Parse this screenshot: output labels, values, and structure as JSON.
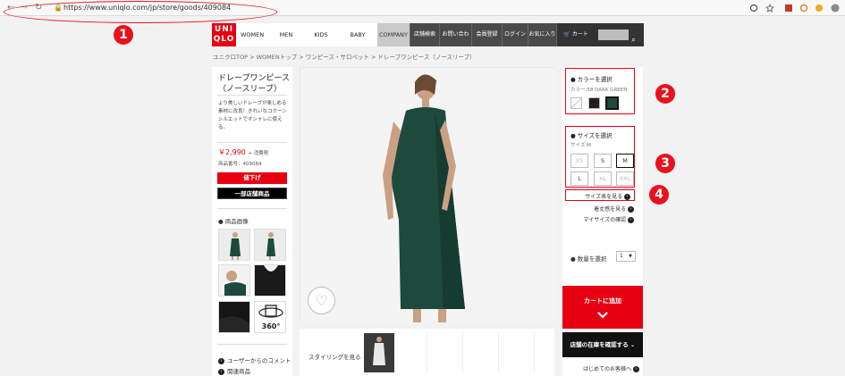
{
  "browser": {
    "url": "https://www.uniqlo.com/jp/store/goods/409084",
    "lock_icon": "lock-icon"
  },
  "annotations": [
    "1",
    "2",
    "3",
    "4"
  ],
  "header": {
    "logo_top": "UNI",
    "logo_bottom": "QLO",
    "nav": [
      "WOMEN",
      "MEN",
      "KIDS",
      "BABY",
      "COMPANY"
    ],
    "utility": [
      "店舗検索",
      "お問い合わせ",
      "会員登録",
      "ログイン",
      "お気に入り",
      "カート"
    ]
  },
  "breadcrumb": "ユニクロTOP > WOMENトップ > ワンピース・サロペット > ドレープワンピース（ノースリーブ）",
  "product": {
    "title": "ドレープワンピース（ノースリーブ）",
    "description": "より美しいドレープが楽しめる素材に改良！きれいなコクーンシルエットでオシャレに使える。",
    "price": "￥2,990",
    "tax": "+ 消費税",
    "number": "商品番号：409084",
    "badge_sale": "値下げ",
    "badge_store": "一部店舗商品",
    "images_label": "商品画像",
    "view360": "360°",
    "links": [
      "ユーザーからのコメント",
      "関連商品"
    ]
  },
  "styling": {
    "label": "スタイリングを見る"
  },
  "color": {
    "heading": "カラーを選択",
    "selected": "カラー:58 DARK GREEN",
    "swatches": [
      "#ffffff",
      "#1f1f1f",
      "#1d4a3d"
    ]
  },
  "size": {
    "heading": "サイズを選択",
    "selected": "サイズ:M",
    "options": [
      {
        "label": "XS",
        "state": "disabled"
      },
      {
        "label": "S",
        "state": "available"
      },
      {
        "label": "M",
        "state": "selected"
      },
      {
        "label": "L",
        "state": "available"
      },
      {
        "label": "XL",
        "state": "disabled"
      },
      {
        "label": "XXL",
        "state": "disabled"
      }
    ]
  },
  "links": {
    "size_chart": "サイズ表を見る",
    "fit": "着丈感を見る",
    "my_size": "マイサイズの確認"
  },
  "quantity": {
    "label": "数量を選択",
    "value": "1"
  },
  "cart": {
    "add": "カートに追加"
  },
  "stock": {
    "label": "店舗の在庫を確認する"
  },
  "first_time": "はじめてのお客様へ",
  "colors": {
    "brand_red": "#e60012",
    "dress_green": "#1d4a3d"
  }
}
